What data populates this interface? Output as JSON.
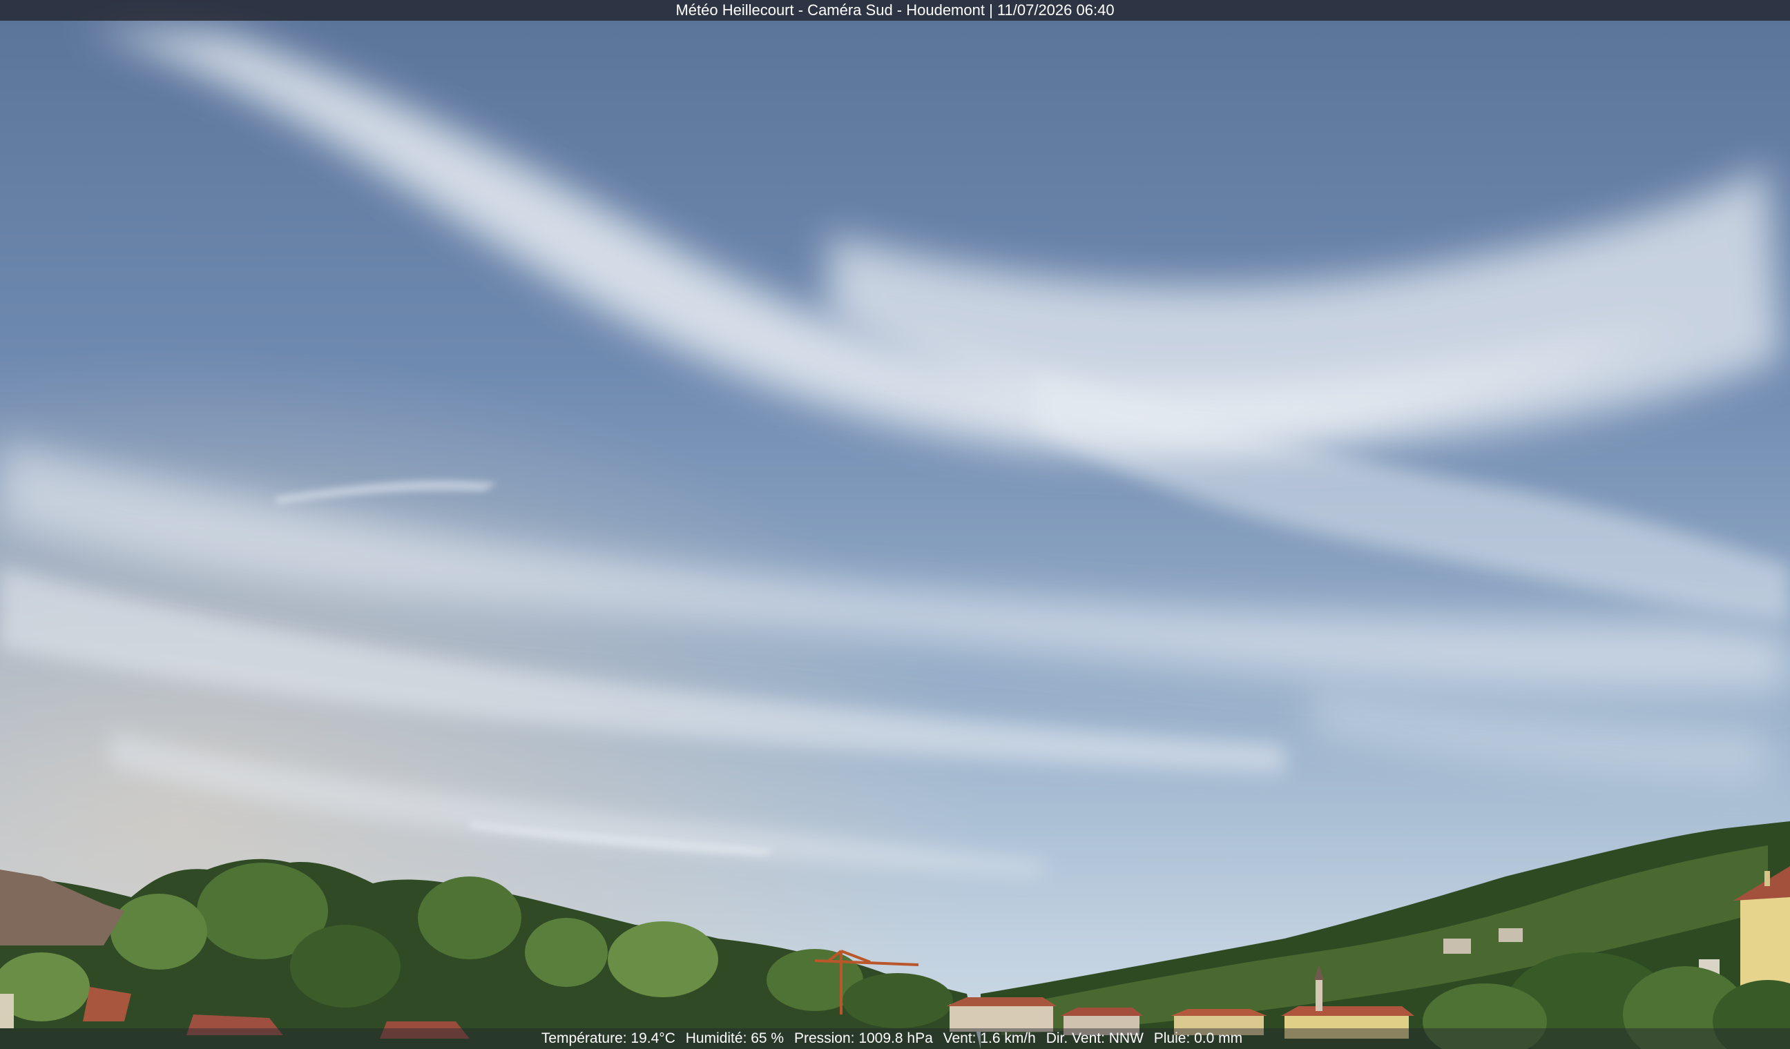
{
  "overlay": {
    "title": "Météo Heillecourt - Caméra Sud - Houdemont | 11/07/2026 06:40",
    "weather": [
      "Température: 19.4°C",
      "Humidité: 65 %",
      "Pression: 1009.8 hPa",
      "Vent: 1.6 km/h",
      "Dir. Vent: NNW",
      "Pluie: 0.0 mm"
    ]
  },
  "colors": {
    "sky_top": "#5e789e",
    "sky_horizon": "#b7c9db",
    "cloud": "#e6ebf1",
    "trees_dark": "#26421f",
    "trees_light": "#6c8e46",
    "roof": "#a9563f",
    "house_yellow": "#e6d48c"
  },
  "icons": [
    "construction-crane",
    "church-steeple"
  ]
}
